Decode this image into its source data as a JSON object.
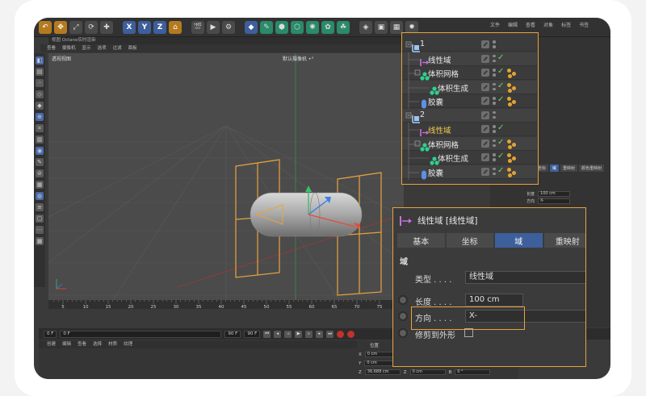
{
  "colors": {
    "accent": "#e8a33d",
    "tab_active": "#3d5f9b",
    "check": "#6fd36f",
    "panel": "#3b3b3b"
  },
  "toolbar": {
    "axes": [
      "X",
      "Y",
      "Z"
    ],
    "right_menu": [
      "文件",
      "编辑",
      "查看",
      "对象",
      "标签",
      "书签"
    ]
  },
  "viewport": {
    "title_bar": "视图  Octane实时渲染",
    "menu": [
      "查看",
      "摄像机",
      "显示",
      "选项",
      "过滤",
      "面板"
    ],
    "label": "透视视图",
    "camera": "默认摄像机 •°"
  },
  "timeline": {
    "ruler_ticks": [
      "5",
      "10",
      "15",
      "20",
      "25",
      "30",
      "35",
      "40",
      "45",
      "50",
      "55",
      "60",
      "65",
      "70",
      "75"
    ],
    "start": "0 F",
    "current": "0 F",
    "end_a": "90 F",
    "end_b": "90 F"
  },
  "materials": {
    "menu": [
      "创建",
      "编辑",
      "查看",
      "选择",
      "材质",
      "纹理"
    ]
  },
  "coords": {
    "header": "位置",
    "x": "0 cm",
    "y": "0 cm",
    "z": "36.688 cm",
    "z2": "0 cm",
    "b": "0 °"
  },
  "mini_attr": {
    "tabs": [
      "基本",
      "坐标",
      "域",
      "重映射",
      "颜色重映射"
    ],
    "length_label": "长度",
    "length_value": "100 cm",
    "dir_label": "方向",
    "dir_value": "X-"
  },
  "objects": [
    {
      "name": "1",
      "icon": "null-icon",
      "level": 0,
      "tags": 0
    },
    {
      "name": "线性域",
      "icon": "linear-field-icon",
      "level": 1,
      "tags": 0
    },
    {
      "name": "体积网格",
      "icon": "volume-mesher-icon",
      "level": 1,
      "tags": 2
    },
    {
      "name": "体积生成",
      "icon": "volume-builder-icon",
      "level": 2,
      "tags": 2
    },
    {
      "name": "胶囊",
      "icon": "capsule-icon",
      "level": 1,
      "tags": 2
    },
    {
      "name": "2",
      "icon": "null-icon",
      "level": 0,
      "tags": 0
    },
    {
      "name": "线性域",
      "icon": "linear-field-icon",
      "level": 1,
      "tags": 0
    },
    {
      "name": "体积网格",
      "icon": "volume-mesher-icon",
      "level": 1,
      "tags": 2
    },
    {
      "name": "体积生成",
      "icon": "volume-builder-icon",
      "level": 2,
      "tags": 2
    },
    {
      "name": "胶囊",
      "icon": "capsule-icon",
      "level": 1,
      "tags": 2
    }
  ],
  "attributes": {
    "title": "线性域 [线性域]",
    "tabs": [
      "基本",
      "坐标",
      "域",
      "重映射"
    ],
    "active_tab": "域",
    "section": "域",
    "type_label": "类型 . . . .",
    "type_value": "线性域",
    "length_label": "长度 . . . .",
    "length_value": "100 cm",
    "direction_label": "方向 . . . .",
    "direction_value": "X-",
    "clip_label": "修剪到外形"
  }
}
